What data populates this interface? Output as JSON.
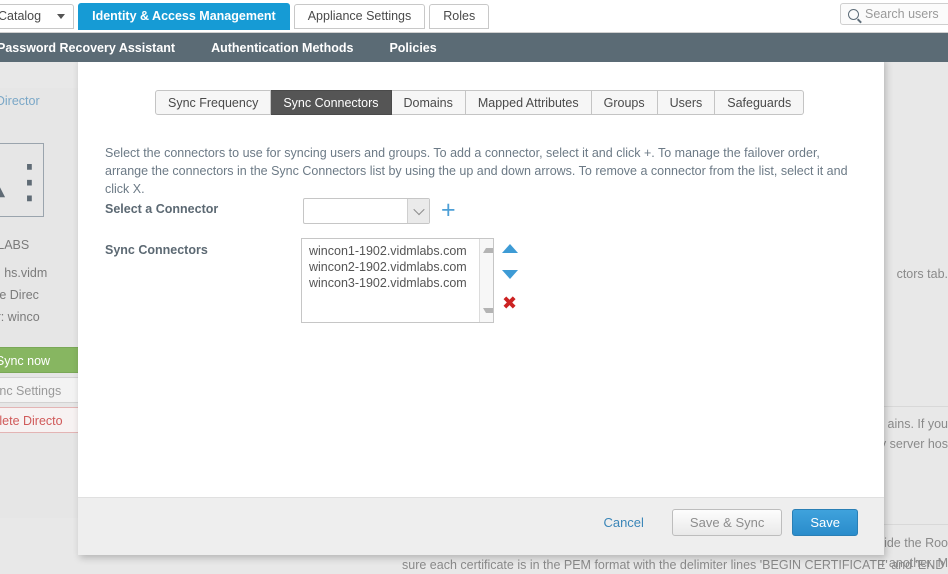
{
  "topbar": {
    "tabs": [
      {
        "label": "Catalog",
        "active": false,
        "has_caret": true
      },
      {
        "label": "Identity & Access Management",
        "active": true,
        "has_caret": false
      },
      {
        "label": "Appliance Settings",
        "active": false,
        "has_caret": false
      },
      {
        "label": "Roles",
        "active": false,
        "has_caret": false
      }
    ],
    "search_placeholder": "Search users"
  },
  "subnav": {
    "items": [
      {
        "label": "Password Recovery Assistant"
      },
      {
        "label": "Authentication Methods"
      },
      {
        "label": "Policies"
      }
    ]
  },
  "sidebar": {
    "back_link": "ck to Director",
    "directory_name": "VIDMLABS",
    "domains_line": "ain(s): hs.vidm",
    "type_line": ": Active Direc",
    "connector_line": "nector: winco",
    "sync_now": "Sync now",
    "sync_settings": "Sync Settings",
    "delete_directory": "Delete Directo"
  },
  "background_text": {
    "fragment_1": "ctors tab.",
    "fragment_2": "ains. If you",
    "fragment_3": "y server hos",
    "fragment_4": "vide the Roo",
    "fragment_5": "r another. M",
    "bottom_line": "sure each certificate is in the PEM format with the delimiter lines 'BEGIN CERTIFICATE' and 'END"
  },
  "modal": {
    "tabs": [
      {
        "label": "Sync Frequency",
        "active": false
      },
      {
        "label": "Sync Connectors",
        "active": true
      },
      {
        "label": "Domains",
        "active": false
      },
      {
        "label": "Mapped Attributes",
        "active": false
      },
      {
        "label": "Groups",
        "active": false
      },
      {
        "label": "Users",
        "active": false
      },
      {
        "label": "Safeguards",
        "active": false
      }
    ],
    "intro": "Select the connectors to use for syncing users and groups. To add a connector, select it and click +. To manage the failover order, arrange the connectors in the Sync Connectors list by using the up and down arrows. To remove a connector from the list, select it and click X.",
    "select_connector_label": "Select a Connector",
    "select_connector_value": "",
    "add_icon": "+",
    "sync_connectors_label": "Sync Connectors",
    "sync_connectors": [
      "wincon1-1902.vidmlabs.com",
      "wincon2-1902.vidmlabs.com",
      "wincon3-1902.vidmlabs.com"
    ],
    "remove_icon": "✖",
    "footer": {
      "cancel": "Cancel",
      "save_and_sync": "Save & Sync",
      "save": "Save"
    }
  },
  "colors": {
    "accent_blue": "#169bd5",
    "subnav_slate": "#5b6b75",
    "active_tab_dark": "#555555",
    "sync_green": "#87b661",
    "delete_red": "#d05a5a",
    "remove_x_red": "#cc2222",
    "arrow_blue": "#3e9bd5"
  }
}
